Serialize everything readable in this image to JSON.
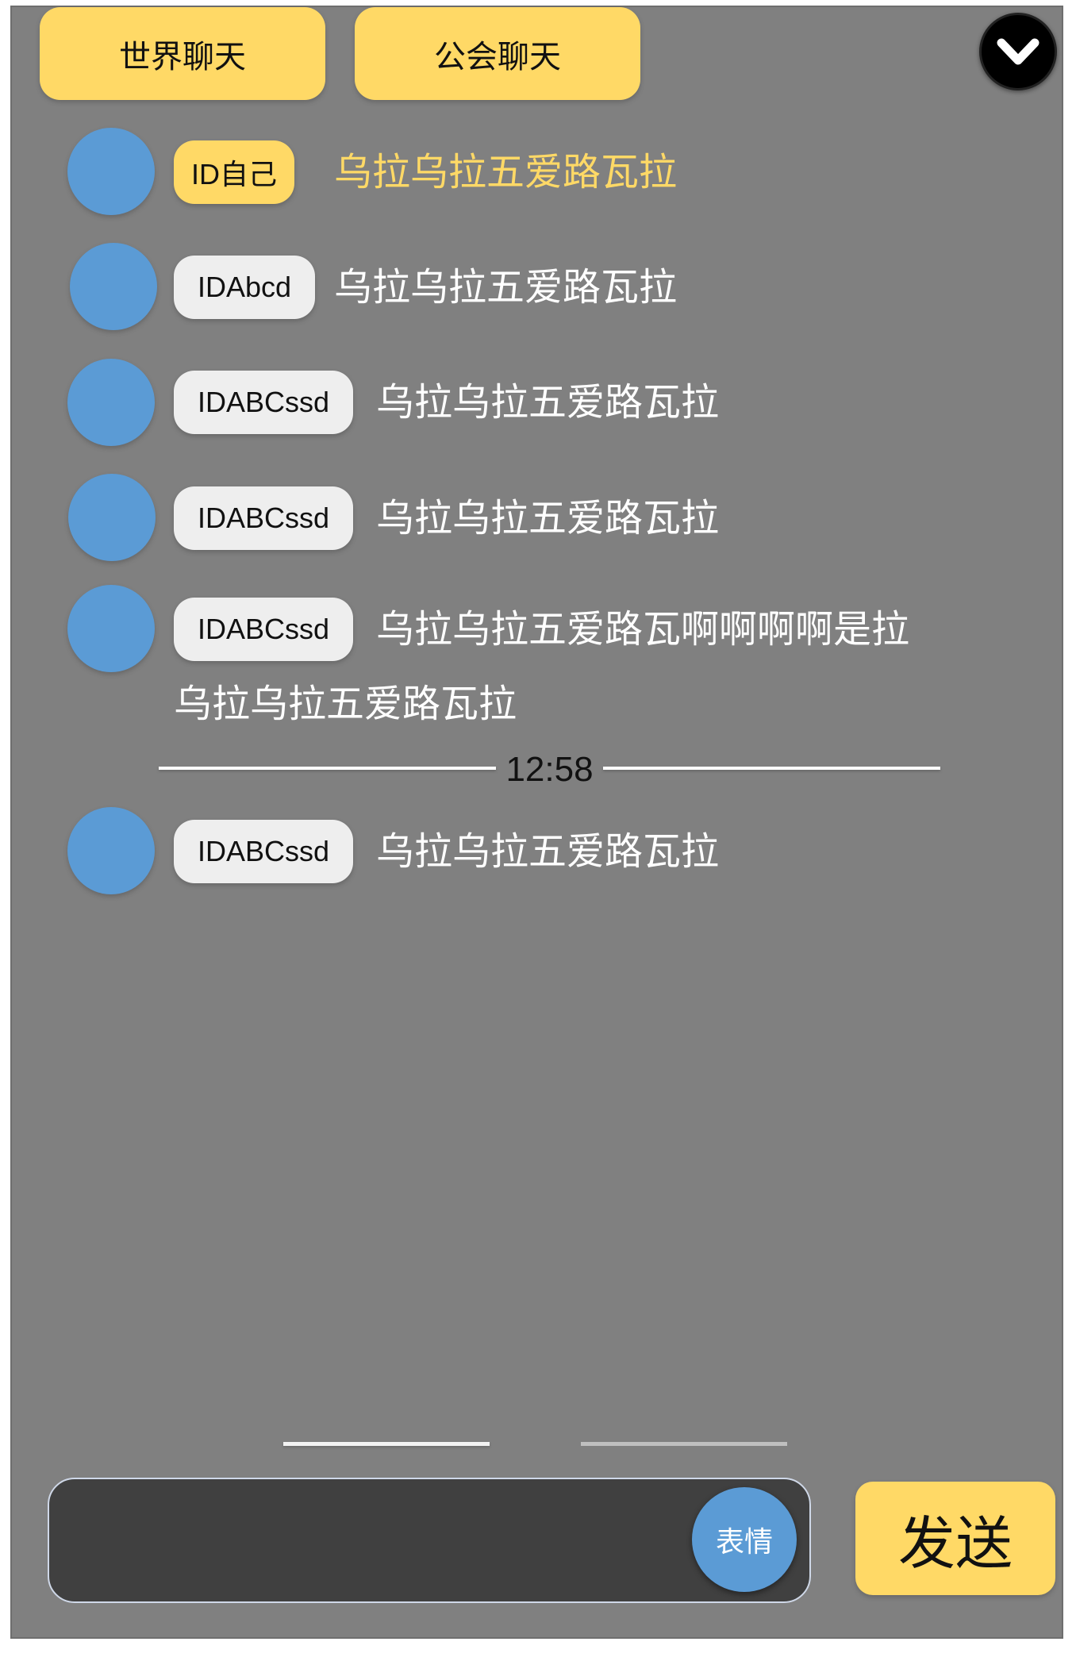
{
  "tabs": {
    "world": "世界聊天",
    "guild": "公会聊天"
  },
  "header": {
    "collapse_icon": "chevron-down-icon"
  },
  "messages": [
    {
      "id": "ID自己",
      "text": "乌拉乌拉五爱路瓦拉",
      "self": true
    },
    {
      "id": "IDAbcd",
      "text": "乌拉乌拉五爱路瓦拉",
      "self": false
    },
    {
      "id": "IDABCssd",
      "text": "乌拉乌拉五爱路瓦拉",
      "self": false
    },
    {
      "id": "IDABCssd",
      "text": "乌拉乌拉五爱路瓦拉",
      "self": false
    },
    {
      "id": "IDABCssd",
      "text": "乌拉乌拉五爱路瓦啊啊啊啊是拉",
      "text_wrap": "乌拉乌拉五爱路瓦拉",
      "self": false
    },
    {
      "id": "IDABCssd",
      "text": "乌拉乌拉五爱路瓦拉",
      "self": false
    }
  ],
  "time_divider": "12:58",
  "pagination": {
    "pages": 2,
    "active_page": 1
  },
  "composer": {
    "input_value": "",
    "emoji_label": "表情",
    "send_label": "发送"
  },
  "colors": {
    "panel_bg": "#808080",
    "tab_bg": "#ffd966",
    "avatar": "#5b9bd5",
    "self_text": "#ffd966",
    "badge_bg": "#eeeeee",
    "input_bg": "#404040"
  }
}
